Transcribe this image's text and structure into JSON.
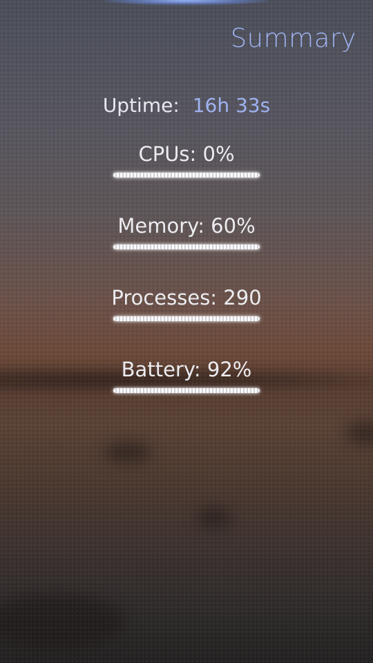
{
  "header": {
    "title": "Summary"
  },
  "uptime": {
    "label": "Uptime:",
    "value": "16h 33s"
  },
  "metrics": [
    {
      "label": "CPUs: 0%",
      "percent": 0
    },
    {
      "label": "Memory: 60%",
      "percent": 60
    },
    {
      "label": "Processes: 290"
    },
    {
      "label": "Battery: 92%",
      "percent": 92
    }
  ],
  "colors": {
    "accent": "#9fb3f2",
    "text": "#ececf0"
  }
}
